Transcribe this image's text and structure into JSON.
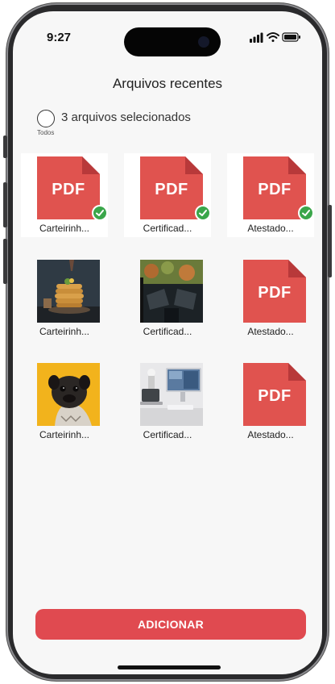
{
  "status_bar": {
    "time": "9:27"
  },
  "header": {
    "title": "Arquivos recentes"
  },
  "selection": {
    "count_text": "3 arquivos selecionados",
    "all_label": "Todos"
  },
  "files": [
    {
      "name": "Carteirinh...",
      "type": "pdf",
      "badge": "PDF",
      "selected": true
    },
    {
      "name": "Certificad...",
      "type": "pdf",
      "badge": "PDF",
      "selected": true
    },
    {
      "name": "Atestado...",
      "type": "pdf",
      "badge": "PDF",
      "selected": true
    },
    {
      "name": "Carteirinh...",
      "type": "image",
      "icon": "pancakes-photo-icon",
      "selected": false
    },
    {
      "name": "Certificad...",
      "type": "image",
      "icon": "car-interior-photo-icon",
      "selected": false
    },
    {
      "name": "Atestado...",
      "type": "pdf",
      "badge": "PDF",
      "selected": false
    },
    {
      "name": "Carteirinh...",
      "type": "image",
      "icon": "pug-photo-icon",
      "selected": false
    },
    {
      "name": "Certificad...",
      "type": "image",
      "icon": "desk-computer-photo-icon",
      "selected": false
    },
    {
      "name": "Atestado...",
      "type": "pdf",
      "badge": "PDF",
      "selected": false
    }
  ],
  "actions": {
    "add_label": "ADICIONAR"
  },
  "colors": {
    "accent": "#e04a50",
    "pdf_red": "#e0534f",
    "pdf_fold": "#b8393a",
    "check_green": "#3aa64a"
  }
}
